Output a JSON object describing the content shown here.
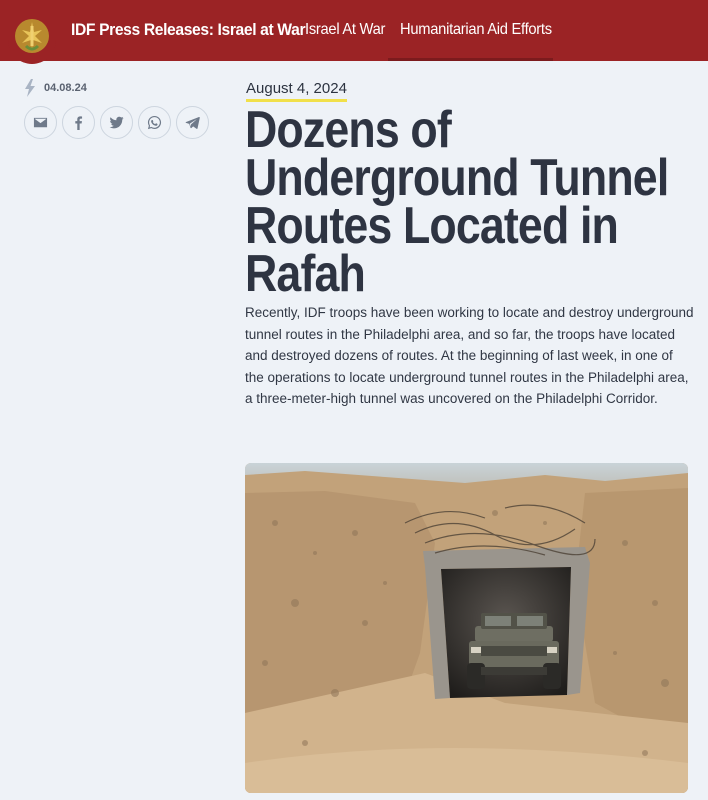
{
  "header": {
    "site_title": "IDF Press Releases: Israel at War",
    "nav": [
      {
        "label": "Israel At War"
      },
      {
        "label": "Humanitarian Aid Efforts"
      }
    ],
    "brand_color": "#9b2325"
  },
  "sidebar": {
    "date_short": "04.08.24",
    "share_icons": [
      "email-icon",
      "facebook-icon",
      "twitter-icon",
      "whatsapp-icon",
      "telegram-icon"
    ]
  },
  "article": {
    "date": "August 4, 2024",
    "title": "Dozens of Underground Tunnel Routes Located in Rafah",
    "body": "Recently, IDF troops have been working to locate and destroy underground tunnel routes in the Philadelphi area, and so far, the troops have located and destroyed dozens of routes. At the beginning of last week, in one of the operations to locate underground tunnel routes in the Philadelphi area, a three-meter-high tunnel was uncovered on the Philadelphi Corridor."
  }
}
